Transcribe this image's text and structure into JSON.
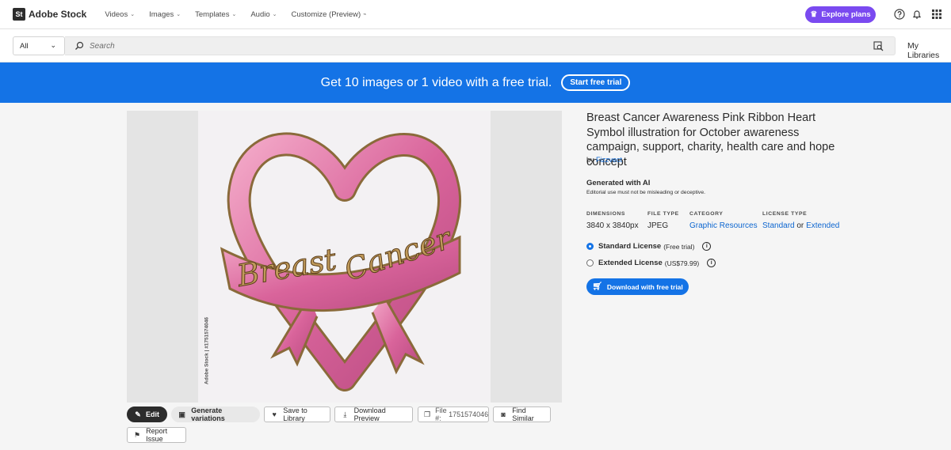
{
  "app": {
    "logo_mark": "St",
    "logo_text": "Adobe Stock"
  },
  "nav": {
    "items": [
      {
        "label": "Videos",
        "chevron": "⌄"
      },
      {
        "label": "Images",
        "chevron": "⌄"
      },
      {
        "label": "Templates",
        "chevron": "⌄"
      },
      {
        "label": "Audio",
        "chevron": "⌄"
      },
      {
        "label": "Customize (Preview)",
        "chevron": "⌁"
      }
    ],
    "explore_label": "Explore plans",
    "icons": [
      "help-icon",
      "bell-icon",
      "apps-grid-icon"
    ]
  },
  "search": {
    "filter_value": "All",
    "placeholder": "Search",
    "my_libraries": "My Libraries"
  },
  "banner": {
    "text": "Get 10 images or 1 video with a free trial.",
    "button": "Start free trial",
    "color": "#1473e6"
  },
  "asset": {
    "title": "Breast Cancer Awareness Pink Ribbon Heart Symbol illustration for October awareness campaign, support, charity, health care and hope concept",
    "by_prefix": "by",
    "author": "Fizzvect",
    "image_text_line1": "Breast",
    "image_text_line2": "Cancer",
    "credit": "Adobe Stock | #1751574046",
    "gen_ai_label": "Generated with AI",
    "gen_ai_note": "Editorial use must not be misleading or deceptive.",
    "meta": {
      "dimensions_label": "DIMENSIONS",
      "dimensions_value": "3840 x 3840px",
      "filetype_label": "FILE TYPE",
      "filetype_value": "JPEG",
      "category_label": "CATEGORY",
      "category_value": "Graphic Resources",
      "license_label": "LICENSE TYPE",
      "license_standard": "Standard",
      "license_or": "or",
      "license_extended": "Extended"
    },
    "licenses": [
      {
        "name": "Standard License",
        "detail": "(Free trial)",
        "selected": true
      },
      {
        "name": "Extended License",
        "detail": "(US$79.99)",
        "selected": false
      }
    ],
    "download_label": "Download with free trial"
  },
  "actions": {
    "edit": "Edit",
    "generate": "Generate variations",
    "save": "Save to Library",
    "download_preview": "Download Preview",
    "file_label": "File #:",
    "file_number": "1751574046",
    "find_similar": "Find Similar",
    "report": "Report Issue"
  },
  "colors": {
    "accent": "#1473e6",
    "explore": "#7a4af0",
    "ribbon": "#e07aa8"
  }
}
